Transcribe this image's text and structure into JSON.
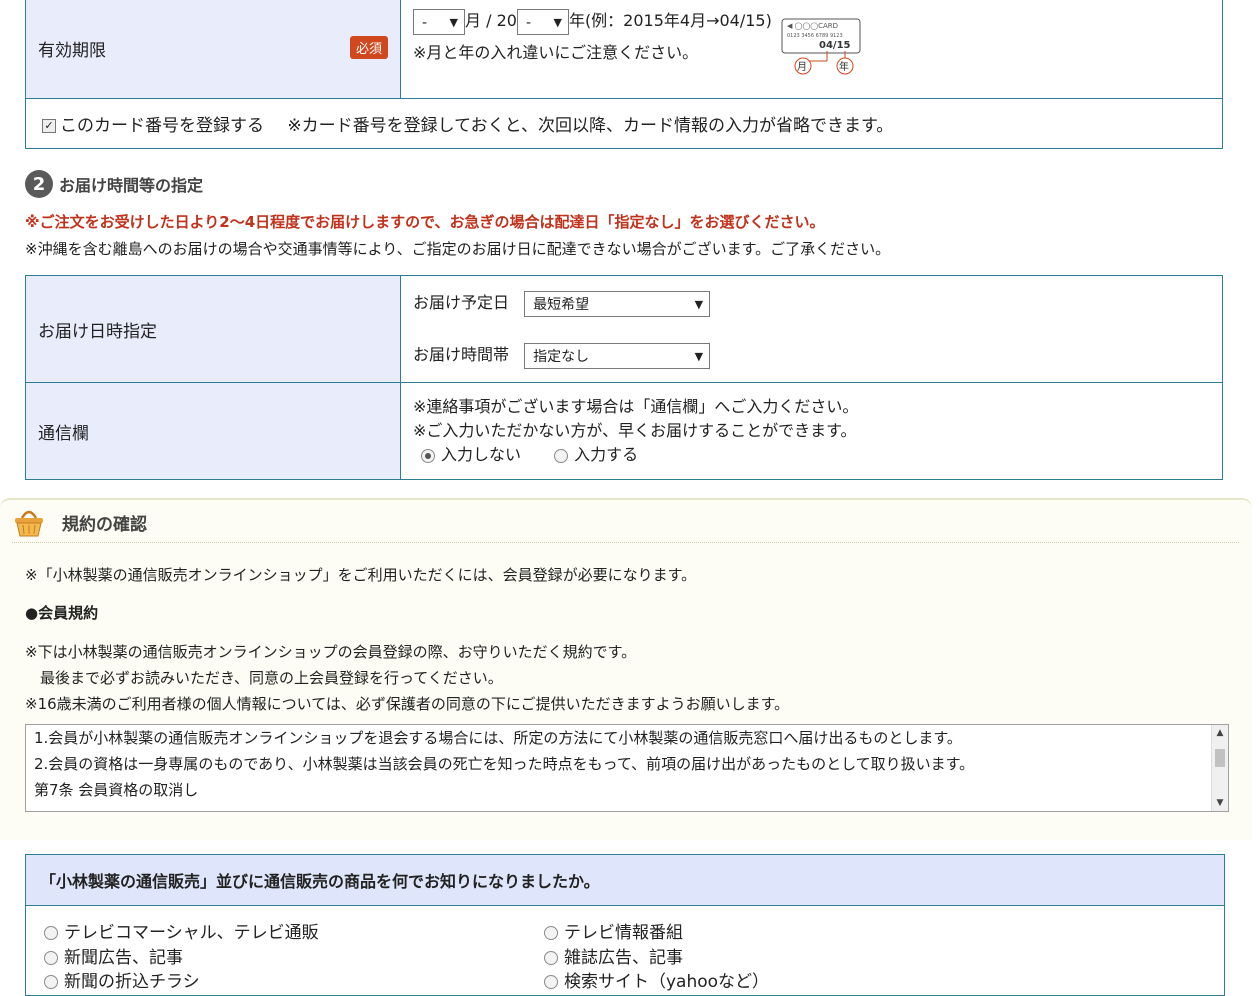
{
  "expiry": {
    "label": "有効期限",
    "required_badge": "必須",
    "month_value": "-",
    "month_suffix": "月 / 20",
    "year_value": "-",
    "year_suffix": "年(例：2015年4月→04/15)",
    "note": "※月と年の入れ違いにご注意ください。",
    "card_illustration": {
      "brand": "◀ ◯◯◯CARD",
      "number": "0123 3456 6789 9123",
      "expiry": "04/15",
      "month_tag": "月",
      "year_tag": "年"
    }
  },
  "register_card": {
    "checked": true,
    "label": "このカード番号を登録する",
    "note": "※カード番号を登録しておくと、次回以降、カード情報の入力が省略できます。"
  },
  "delivery_section": {
    "number": "2",
    "title": "お届け時間等の指定",
    "notice_red": "※ご注文をお受けした日より2〜4日程度でお届けしますので、お急ぎの場合は配達日「指定なし」をお選びください。",
    "notice": "※沖縄を含む離島へのお届けの場合や交通事情等により、ご指定のお届け日に配達できない場合がございます。ご了承ください。",
    "datetime": {
      "label": "お届け日時指定",
      "date_label": "お届け予定日",
      "date_value": "最短希望",
      "time_label": "お届け時間帯",
      "time_value": "指定なし"
    },
    "message": {
      "label": "通信欄",
      "line1": "※連絡事項がございます場合は「通信欄」へご入力ください。",
      "line2": "※ご入力いただかない方が、早くお届けすることができます。",
      "option_no": "入力しない",
      "option_yes": "入力する",
      "selected": "入力しない"
    }
  },
  "terms": {
    "title": "規約の確認",
    "intro": "※「小林製薬の通信販売オンラインショップ」をご利用いただくには、会員登録が必要になります。",
    "member_heading": "●会員規約",
    "note1": "※下は小林製薬の通信販売オンラインショップの会員登録の際、お守りいただく規約です。",
    "note2": "　最後まで必ずお読みいただき、同意の上会員登録を行ってください。",
    "note3": "※16歳未満のご利用者様の個人情報については、必ず保護者の同意の下にご提供いただきますようお願いします。",
    "text_lines": [
      "1.会員が小林製薬の通信販売オンラインショップを退会する場合には、所定の方法にて小林製薬の通信販売窓口へ届け出るものとします。",
      "2.会員の資格は一身専属のものであり、小林製薬は当該会員の死亡を知った時点をもって、前項の届け出があったものとして取り扱います。",
      "第7条 会員資格の取消し"
    ]
  },
  "survey": {
    "question": "「小林製薬の通信販売」並びに通信販売の商品を何でお知りになりましたか。",
    "options_left": [
      "テレビコマーシャル、テレビ通販",
      "新聞広告、記事",
      "新聞の折込チラシ"
    ],
    "options_right": [
      "テレビ情報番組",
      "雑誌広告、記事",
      "検索サイト（yahooなど）"
    ]
  },
  "colors": {
    "table_border": "#2b7e94",
    "header_bg": "#e9ecfb",
    "required_badge": "#d0481e",
    "warning_text": "#c0321c",
    "survey_header_bg": "#dfe6fb"
  }
}
